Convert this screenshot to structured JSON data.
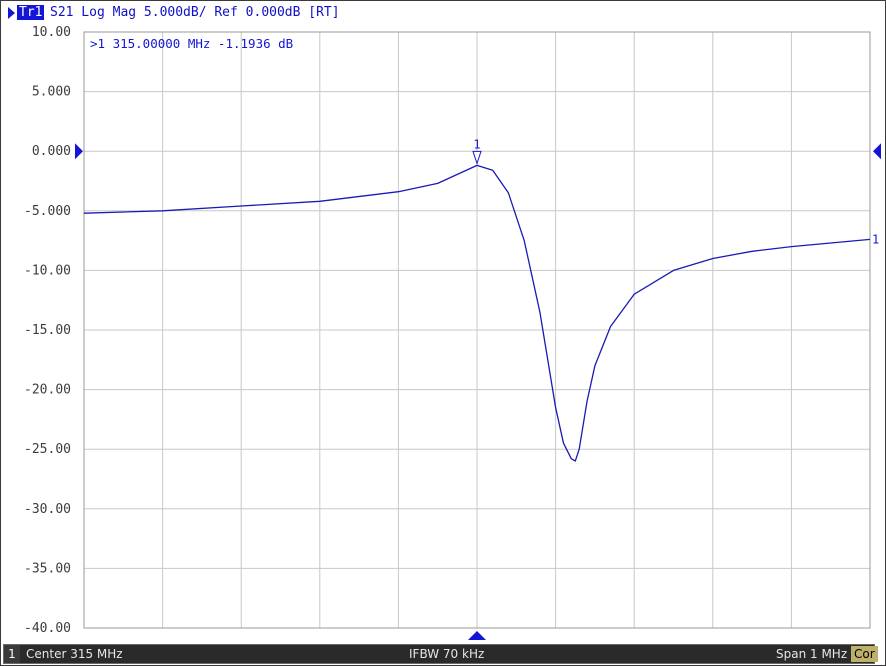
{
  "trace_header": {
    "trace_label": "Tr1",
    "trace_text": "S21 Log Mag 5.000dB/ Ref 0.000dB [RT]"
  },
  "marker_readout": ">1  315.00000 MHz -1.1936 dB",
  "status_bar": {
    "channel": "1",
    "center": "Center 315 MHz",
    "ifbw": "IFBW 70 kHz",
    "span": "Span 1 MHz",
    "correction": "Cor"
  },
  "colors": {
    "trace": "#1a1ab4",
    "grid": "#c8c8c8",
    "axis_text": "#3c3c3c",
    "marker": "#1515d8"
  },
  "chart_data": {
    "type": "line",
    "title": "S21 Log Mag 5.000dB/ Ref 0.000dB [RT]",
    "xlabel": "",
    "ylabel": "",
    "xlim": [
      314.5,
      315.5
    ],
    "ylim": [
      -40,
      10
    ],
    "y_ticks": [
      10,
      5,
      0,
      -5,
      -10,
      -15,
      -20,
      -25,
      -30,
      -35,
      -40
    ],
    "y_tick_labels": [
      "10.00",
      "5.000",
      "0.000",
      "-5.000",
      "-10.00",
      "-15.00",
      "-20.00",
      "-25.00",
      "-30.00",
      "-35.00",
      "-40.00"
    ],
    "x_divisions": 10,
    "grid": true,
    "reference_level": 0,
    "series": [
      {
        "name": "S21",
        "x": [
          314.5,
          314.6,
          314.7,
          314.8,
          314.9,
          314.95,
          315.0,
          315.02,
          315.04,
          315.06,
          315.08,
          315.1,
          315.11,
          315.12,
          315.125,
          315.13,
          315.14,
          315.15,
          315.17,
          315.2,
          315.25,
          315.3,
          315.35,
          315.4,
          315.45,
          315.5
        ],
        "y": [
          -5.2,
          -5.0,
          -4.6,
          -4.2,
          -3.4,
          -2.7,
          -1.1936,
          -1.6,
          -3.5,
          -7.5,
          -13.5,
          -21.5,
          -24.5,
          -25.8,
          -26.0,
          -25.0,
          -21.0,
          -18.0,
          -14.7,
          -12.0,
          -10.0,
          -9.0,
          -8.4,
          -8.0,
          -7.7,
          -7.4
        ]
      }
    ],
    "markers": [
      {
        "id": "1",
        "x": 315.0,
        "y": -1.1936,
        "label": "1"
      }
    ],
    "trace_end_label": "1"
  }
}
